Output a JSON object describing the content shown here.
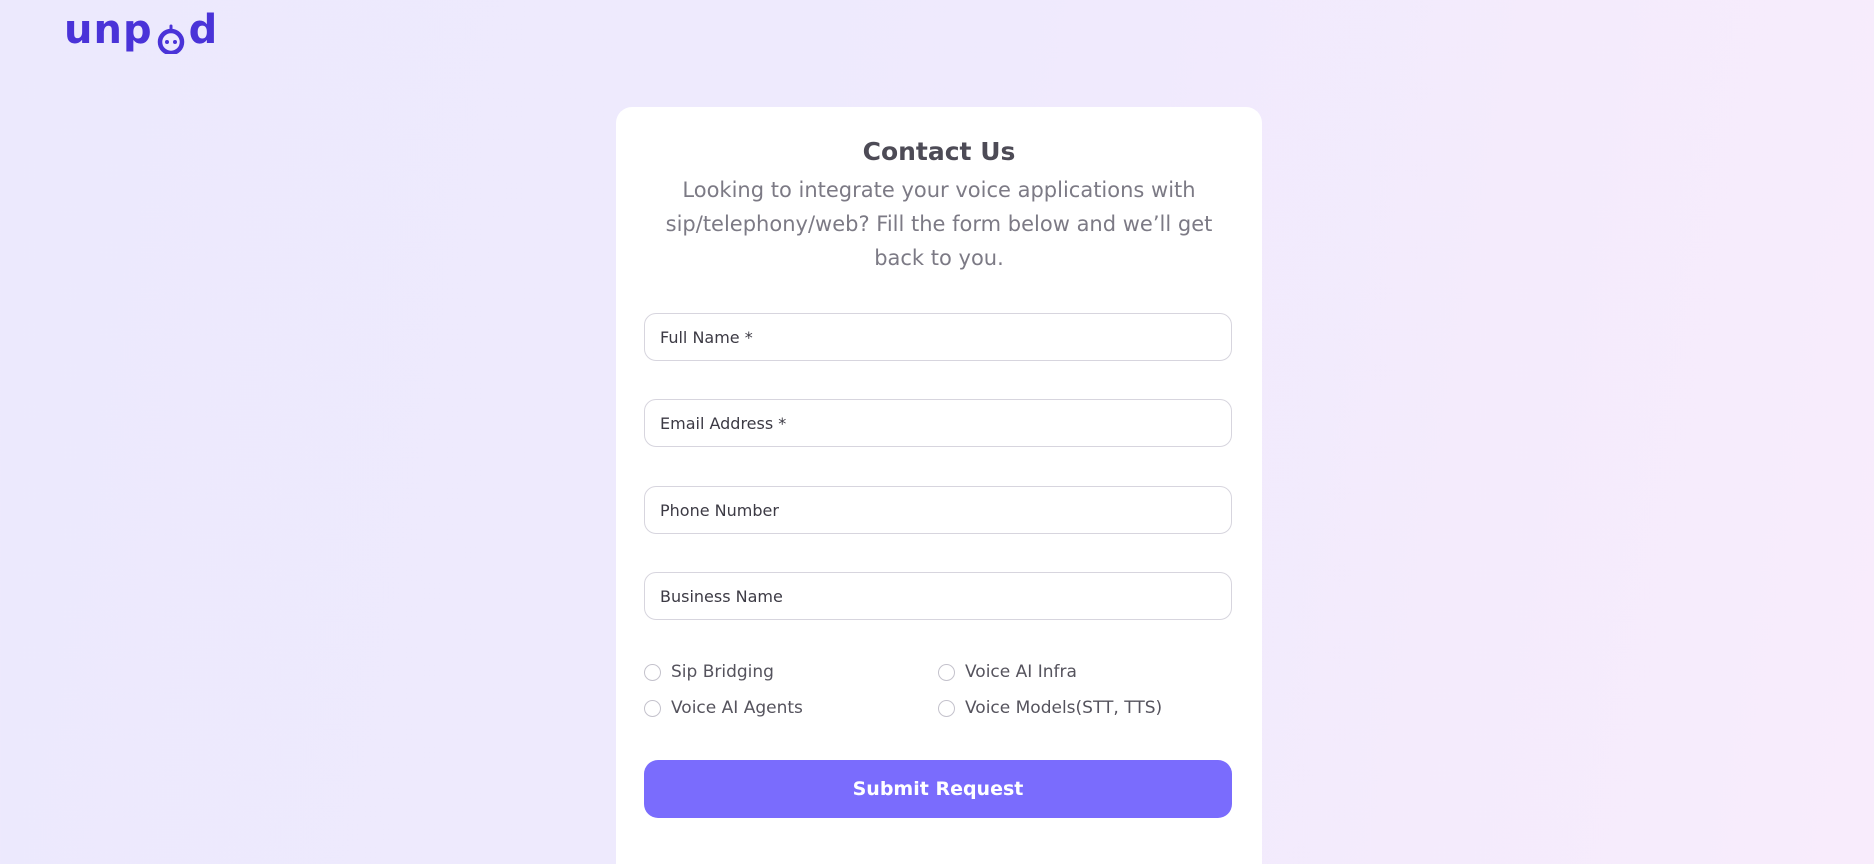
{
  "brand": {
    "logo_text_left": "unp",
    "logo_text_right": "d",
    "color": "#4a33d8"
  },
  "form": {
    "title": "Contact Us",
    "subtitle": "Looking to integrate your voice applications with sip/telephony/web? Fill the form below and we’ll get back to you.",
    "fields": [
      {
        "placeholder": "Full Name *",
        "value": ""
      },
      {
        "placeholder": "Email Address *",
        "value": ""
      },
      {
        "placeholder": "Phone Number",
        "value": ""
      },
      {
        "placeholder": "Business Name",
        "value": ""
      }
    ],
    "options": [
      {
        "label": "Sip Bridging",
        "selected": false
      },
      {
        "label": "Voice AI Infra",
        "selected": false
      },
      {
        "label": "Voice AI Agents",
        "selected": false
      },
      {
        "label": "Voice Models(STT, TTS)",
        "selected": false
      }
    ],
    "submit_label": "Submit Request",
    "accent_color": "#7a6cfd"
  }
}
